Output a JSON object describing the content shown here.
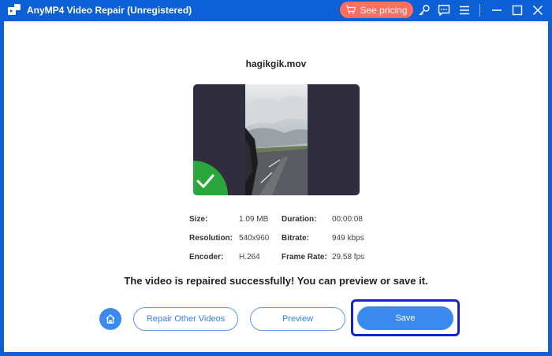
{
  "window": {
    "title": "AnyMP4 Video Repair (Unregistered)",
    "pricing_label": "See pricing",
    "icons": [
      "app-logo-icon",
      "cart-icon",
      "key-icon",
      "feedback-icon",
      "menu-icon",
      "minimize-icon",
      "maximize-icon",
      "close-icon"
    ]
  },
  "file": {
    "name": "hagikgik.mov",
    "status_icon": "check-icon"
  },
  "info": {
    "size_label": "Size:",
    "size_value": "1.09 MB",
    "duration_label": "Duration:",
    "duration_value": "00:00:08",
    "resolution_label": "Resolution:",
    "resolution_value": "540x960",
    "bitrate_label": "Bitrate:",
    "bitrate_value": "949 kbps",
    "encoder_label": "Encoder:",
    "encoder_value": "H.264",
    "framerate_label": "Frame Rate:",
    "framerate_value": "29.58 fps"
  },
  "message": "The video is repaired successfully! You can preview or save it.",
  "actions": {
    "home_icon": "home-icon",
    "repair_other_label": "Repair Other Videos",
    "preview_label": "Preview",
    "save_label": "Save"
  },
  "colors": {
    "titlebar": "#0d5fd6",
    "pricing": "#ff6f5c",
    "accent": "#3b8af0",
    "success": "#2aa63c",
    "highlight": "#1422c8"
  }
}
